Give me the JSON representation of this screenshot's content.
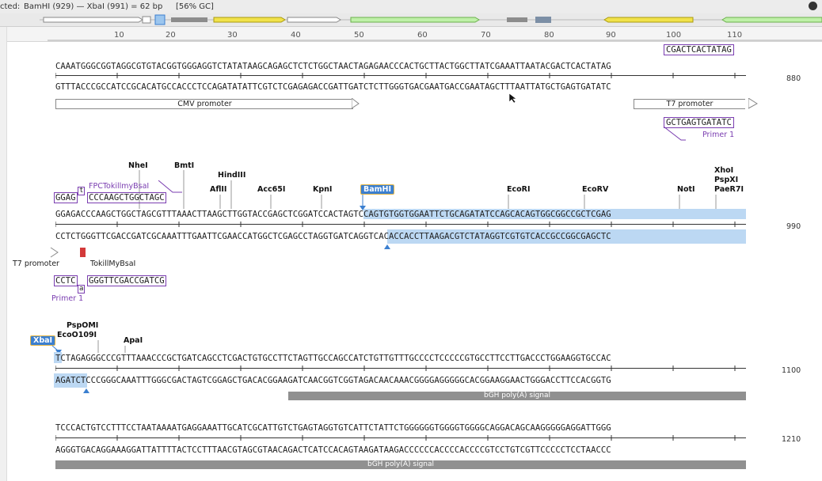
{
  "status": {
    "prefix": "cted:",
    "range": "BamHI (929)  —  XbaI (991)  =  62 bp",
    "gc": "[56% GC]"
  },
  "ruler": {
    "ticks": [
      "10",
      "20",
      "30",
      "40",
      "50",
      "60",
      "70",
      "80",
      "90",
      "100",
      "110"
    ]
  },
  "block1": {
    "primer_top": "CGACTCACTATAG",
    "top": "CAAATGGGCGGTAGGCGTGTACGGTGGGAGGTCTATATAAGCAGAGCTCTCTGGCTAACTAGAGAACCCACTGCTTACTGGCTTATCGAAATTAATACGACTCACTATAG",
    "bottom": "GTTTACCCGCCATCCGCACATGCCACCCTCCAGATATATTCGTCTCGAGAGACCGATTGATCTCTTGGGTGACGAATGACCGAATAGCTTTAATTATGCTGAGTGATATC",
    "pos": "880",
    "feat_cmv": "CMV promoter",
    "feat_t7": "T7 promoter",
    "primer_bottom": "GCTGAGTGATATC",
    "primer_label": "Primer 1"
  },
  "block2": {
    "enzymes": [
      "NheI",
      "BmtI",
      "HindIII",
      "AflII",
      "Acc65I",
      "KpnI",
      "BamHI",
      "EcoRI",
      "EcoRV",
      "NotI",
      "XhoI",
      "PspXI",
      "PaeR7I"
    ],
    "fpc_label": "FPCTokillmyBsaI",
    "fpc_left": "GGAG",
    "fpc_mark": "t",
    "fpc_right": "CCCAAGCTGGCTAGC",
    "top": "GGAGACCCAAGCTGGCTAGCGTTTAAACTTAAGCTTGGTACCGAGCTCGGATCCACTAGTCCAGTGTGGTGGAATTCTGCAGATATCCAGCACAGTGGCGGCCGCTCGAG",
    "bottom": "CCTCTGGGTTCGACCGATCGCAAATTTGAATTCGAACCATGGCTCGAGCCTAGGTGATCAGGTCACACCACCTTAAGACGTCTATAGGTCGTGTCACCGCCGGCGAGCTC",
    "pos": "990",
    "feat_t7": "T7 promoter",
    "feat_bsa": "TokillMyBsaI",
    "primer_left": "CCTC",
    "primer_mark": "a",
    "primer_right": "GGGTTCGACCGATCG",
    "primer_label": "Primer 1"
  },
  "block3": {
    "enzymes": [
      "XbaI",
      "PspOMI",
      "EcoO109I",
      "ApaI"
    ],
    "top": "TCTAGAGGGCCCGTTTAAACCCGCTGATCAGCCTCGACTGTGCCTTCTAGTTGCCAGCCATCTGTTGTTTGCCCCTCCCCCGTGCCTTCCTTGACCCTGGAAGGTGCCAC",
    "bottom": "AGATCTCCCGGGCAAATTTGGGCGACTAGTCGGAGCTGACACGGAAGATCAACGGTCGGTAGACAACAAACGGGGAGGGGGCACGGAAGGAACTGGGACCTTCCACGGTG",
    "pos": "1100",
    "feat_bgh": "bGH poly(A) signal"
  },
  "block4": {
    "top": "TCCCACTGTCCTTTCCTAATAAAATGAGGAAATTGCATCGCATTGTCTGAGTAGGTGTCATTCTATTCTGGGGGGTGGGGTGGGGCAGGACAGCAAGGGGGAGGATTGGG",
    "bottom": "AGGGTGACAGGAAAGGATTATTTTACTCCTTTAACGTAGCGTAACAGACTCATCCACAGTAAGATAAGACCCCCCACCCCACCCCGTCCTGTCGTTCCCCCTCCTAACCC",
    "pos": "1210",
    "feat_bgh": "bGH poly(A) signal"
  },
  "colors": {
    "selection": "#bcd8f3",
    "primer": "#7a3db0",
    "bamhi_badge": "#3b7fd0",
    "grey_feature": "#909090"
  }
}
